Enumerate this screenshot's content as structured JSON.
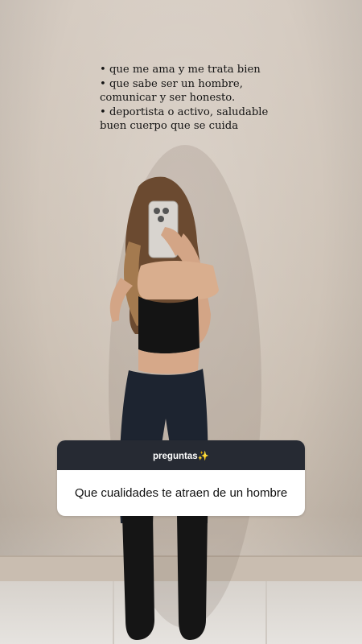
{
  "story": {
    "text_lines": [
      "• que me ama y me trata bien",
      "• que sabe ser un hombre,",
      "comunicar y ser honesto.",
      "• deportista o activo, saludable",
      "buen cuerpo que se cuida"
    ]
  },
  "question_sticker": {
    "header_label": "preguntas✨",
    "question_text": "Que cualidades te atraen de un hombre"
  },
  "icons": {
    "sparkles": "sparkles-icon"
  },
  "colors": {
    "sticker_header": "#262a33",
    "sticker_body": "#ffffff",
    "text": "#141414"
  }
}
